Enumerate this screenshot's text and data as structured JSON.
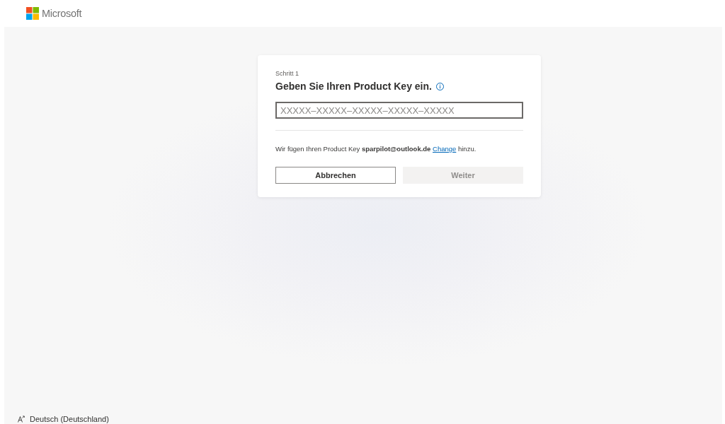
{
  "header": {
    "logo_text": "Microsoft"
  },
  "card": {
    "step": "Schritt 1",
    "title": "Geben Sie Ihren Product Key ein.",
    "product_key_field": {
      "placeholder": "XXXXX–XXXXX–XXXXX–XXXXX–XXXXX"
    },
    "notice": {
      "text": "Wir fügen Ihren Product Key **sparpilot@outlook.de**",
      "link": "Change",
      "after": "hinzu."
    },
    "buttons": [
      {
        "label": "Abbrechen",
        "kind": "secondary",
        "disabled": false
      },
      {
        "label": "Weiter",
        "kind": "primary",
        "disabled": true
      }
    ]
  },
  "footer": {
    "language": "Deutsch (Deutschland)"
  }
}
